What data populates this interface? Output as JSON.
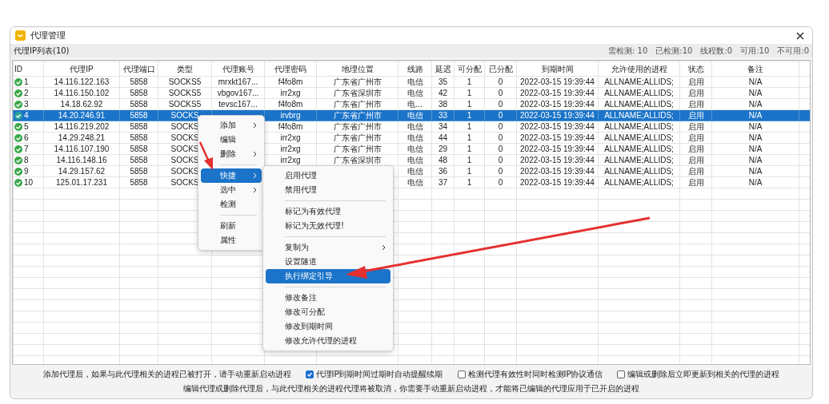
{
  "window": {
    "title": "代理管理"
  },
  "list_header": {
    "title": "代理IP列表(10)",
    "stats": [
      "需检测: 10",
      "已检测:10",
      "线程数:0",
      "可用:10",
      "不可用:0"
    ]
  },
  "table": {
    "columns": [
      "ID",
      "代理IP",
      "代理端口",
      "类型",
      "代理账号",
      "代理密码",
      "地理位置",
      "线路",
      "延迟",
      "可分配",
      "已分配",
      "到期时间",
      "允许使用的进程",
      "状态",
      "备注"
    ],
    "rows": [
      {
        "selected": false,
        "cells": [
          "1",
          "14.116.122.163",
          "5858",
          "SOCKS5",
          "mrxkt167...",
          "f4fo8m",
          "广东省广州市",
          "电信",
          "35",
          "1",
          "0",
          "2022-03-15 19:39:44",
          "ALLNAME;ALLIDS;",
          "启用",
          "N/A"
        ]
      },
      {
        "selected": false,
        "cells": [
          "2",
          "14.116.150.102",
          "5858",
          "SOCKS5",
          "vbgov167...",
          "irr2xg",
          "广东省深圳市",
          "电信",
          "42",
          "1",
          "0",
          "2022-03-15 19:39:44",
          "ALLNAME;ALLIDS;",
          "启用",
          "N/A"
        ]
      },
      {
        "selected": false,
        "cells": [
          "3",
          "14.18.62.92",
          "5858",
          "SOCKS5",
          "tevsc167...",
          "f4fo8m",
          "广东省广州市",
          "电...",
          "38",
          "1",
          "0",
          "2022-03-15 19:39:44",
          "ALLNAME;ALLIDS;",
          "启用",
          "N/A"
        ]
      },
      {
        "selected": true,
        "cells": [
          "4",
          "14.20.246.91",
          "5858",
          "SOCKS",
          "",
          "irvbrg",
          "广东省广州市",
          "电信",
          "33",
          "1",
          "0",
          "2022-03-15 19:39:44",
          "ALLNAME;ALLIDS;",
          "启用",
          "N/A"
        ]
      },
      {
        "selected": false,
        "cells": [
          "5",
          "14.116.219.202",
          "5858",
          "SOCKS",
          "",
          "f4fo8m",
          "广东省广州市",
          "电信",
          "34",
          "1",
          "0",
          "2022-03-15 19:39:44",
          "ALLNAME;ALLIDS;",
          "启用",
          "N/A"
        ]
      },
      {
        "selected": false,
        "cells": [
          "6",
          "14.29.248.21",
          "5858",
          "SOCKS",
          "",
          "irr2xg",
          "广东省广州市",
          "电信",
          "44",
          "1",
          "0",
          "2022-03-15 19:39:44",
          "ALLNAME;ALLIDS;",
          "启用",
          "N/A"
        ]
      },
      {
        "selected": false,
        "cells": [
          "7",
          "14.116.107.190",
          "5858",
          "SOCKS",
          "",
          "irr2xg",
          "广东省广州市",
          "电信",
          "29",
          "1",
          "0",
          "2022-03-15 19:39:44",
          "ALLNAME;ALLIDS;",
          "启用",
          "N/A"
        ]
      },
      {
        "selected": false,
        "cells": [
          "8",
          "14.116.148.16",
          "5858",
          "SOCKS",
          "",
          "irr2xg",
          "广东省深圳市",
          "电信",
          "48",
          "1",
          "0",
          "2022-03-15 19:39:44",
          "ALLNAME;ALLIDS;",
          "启用",
          "N/A"
        ]
      },
      {
        "selected": false,
        "cells": [
          "9",
          "14.29.157.62",
          "5858",
          "SOCKS",
          "",
          "",
          "",
          "电信",
          "36",
          "1",
          "0",
          "2022-03-15 19:39:44",
          "ALLNAME;ALLIDS;",
          "启用",
          "N/A"
        ]
      },
      {
        "selected": false,
        "cells": [
          "10",
          "125.01.17.231",
          "5858",
          "SOCKS",
          "",
          "",
          "",
          "电信",
          "37",
          "1",
          "0",
          "2022-03-15 19:39:44",
          "ALLNAME;ALLIDS;",
          "启用",
          "N/A"
        ]
      }
    ]
  },
  "context_menu": {
    "items": [
      {
        "kind": "item",
        "label": "添加",
        "submenu": true,
        "selected": false
      },
      {
        "kind": "item",
        "label": "编辑",
        "submenu": false,
        "selected": false
      },
      {
        "kind": "item",
        "label": "删除",
        "submenu": true,
        "selected": false
      },
      {
        "kind": "separator"
      },
      {
        "kind": "item",
        "label": "快捷",
        "submenu": true,
        "selected": true
      },
      {
        "kind": "item",
        "label": "选中",
        "submenu": true,
        "selected": false
      },
      {
        "kind": "item",
        "label": "检测",
        "submenu": false,
        "selected": false
      },
      {
        "kind": "separator"
      },
      {
        "kind": "item",
        "label": "刷新",
        "submenu": false,
        "selected": false
      },
      {
        "kind": "item",
        "label": "属性",
        "submenu": false,
        "selected": false
      }
    ]
  },
  "submenu": {
    "items": [
      {
        "kind": "item",
        "label": "启用代理",
        "submenu": false,
        "selected": false
      },
      {
        "kind": "item",
        "label": "禁用代理",
        "submenu": false,
        "selected": false
      },
      {
        "kind": "separator"
      },
      {
        "kind": "item",
        "label": "标记为有效代理",
        "submenu": false,
        "selected": false
      },
      {
        "kind": "item",
        "label": "标记为无效代理!",
        "submenu": false,
        "selected": false
      },
      {
        "kind": "separator"
      },
      {
        "kind": "item",
        "label": "复制为",
        "submenu": true,
        "selected": false
      },
      {
        "kind": "item",
        "label": "设置隧道",
        "submenu": false,
        "selected": false
      },
      {
        "kind": "item",
        "label": "执行绑定引导",
        "submenu": false,
        "selected": true
      },
      {
        "kind": "separator"
      },
      {
        "kind": "item",
        "label": "修改备注",
        "submenu": false,
        "selected": false
      },
      {
        "kind": "item",
        "label": "修改可分配",
        "submenu": false,
        "selected": false
      },
      {
        "kind": "item",
        "label": "修改到期时间",
        "submenu": false,
        "selected": false
      },
      {
        "kind": "item",
        "label": "修改允许代理的进程",
        "submenu": false,
        "selected": false
      }
    ]
  },
  "footer": {
    "note": "添加代理后，如果与此代理相关的进程已被打开，请手动重新启动进程",
    "options": [
      {
        "label": "代理IP到期时间过期时自动提醒续期",
        "checked": true
      },
      {
        "label": "检测代理有效性时同时检测IP协议通信",
        "checked": false
      },
      {
        "label": "编辑或删除后立即更新到相关的代理的进程",
        "checked": false
      }
    ],
    "hint": "编辑代理或删除代理后，与此代理相关的进程代理将被取消，你需要手动重新启动进程，才能将已编辑的代理应用于已开启的进程"
  }
}
